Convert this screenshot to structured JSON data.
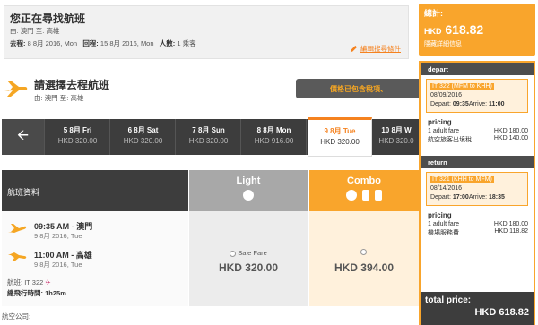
{
  "summary": {
    "title": "您正在尋找航班",
    "route_from_label": "由:",
    "route_from": "澳門",
    "route_to_label": "至:",
    "route_to": "高雄",
    "depart_label": "去程:",
    "depart_date": "8 8月 2016, Mon",
    "return_label": "回程:",
    "return_date": "15 8月 2016, Mon",
    "pax_label": "人數:",
    "pax": "1 乘客",
    "edit_link": "編輯搜尋條件"
  },
  "choose": {
    "heading": "請選擇去程航班",
    "from_label": "由:",
    "from": "澳門",
    "to_label": "至:",
    "to": "高雄"
  },
  "price_note": "價格已包含稅項、",
  "dates": [
    {
      "day": "5 8月 Fri",
      "price": "HKD 320.00"
    },
    {
      "day": "6 8月 Sat",
      "price": "HKD 320.00"
    },
    {
      "day": "7 8月 Sun",
      "price": "HKD 320.00"
    },
    {
      "day": "8 8月 Mon",
      "price": "HKD 916.00"
    },
    {
      "day": "9 8月 Tue",
      "price": "HKD 320.00"
    },
    {
      "day": "10 8月 W",
      "price": "HKD 320.0"
    }
  ],
  "fares": {
    "header": "航班資料",
    "light_label": "Light",
    "combo_label": "Combo",
    "depart_time": "09:35 AM",
    "depart_city": "澳門",
    "depart_date": "9 8月 2016, Tue",
    "arrive_time": "11:00 AM",
    "arrive_city": "高雄",
    "arrive_date": "9 8月 2016, Tue",
    "flight_label": "航班:",
    "flight_no": "IT 322",
    "duration_label": "總飛行時間:",
    "duration": "1h25m",
    "light_option": "Sale Fare",
    "light_price": "HKD 320.00",
    "combo_price": "HKD 394.00",
    "airline_label": "航空公司:"
  },
  "side": {
    "total_label": "總計:",
    "total_currency": "HKD",
    "total_amount": "618.82",
    "details_link": "隱藏詳細信息",
    "depart_header": "depart",
    "depart_flight": "IT 322 (MFM to KHH)",
    "depart_date": "08/09/2016",
    "depart_times_a": "Depart: ",
    "depart_time": "09:35",
    "depart_times_b": "Arrive: ",
    "arrive_time": "11:00",
    "pricing_label": "pricing",
    "depart_fare_label": "1 adult fare",
    "depart_fare": "HKD 180.00",
    "depart_tax_label": "航空旅客出境稅",
    "depart_tax": "HKD 140.00",
    "return_header": "return",
    "return_flight": "IT 321 (KHH to MFM)",
    "return_date": "08/14/2016",
    "return_times_a": "Depart: ",
    "return_depart_time": "17:00",
    "return_times_b": "Arrive: ",
    "return_arrive_time": "18:35",
    "return_pricing_label": "pricing",
    "return_fare_label": "1 adult fare",
    "return_fare": "HKD 180.00",
    "return_tax_label": "機場服務費",
    "return_tax": "HKD 118.82",
    "grand_total_label": "total price:",
    "grand_total": "HKD 618.82"
  },
  "colors": {
    "accent": "#f9a52c",
    "dark": "#3d3d3d"
  }
}
